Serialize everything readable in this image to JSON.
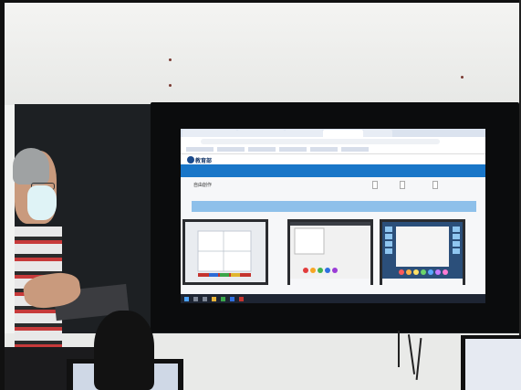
{
  "browser": {
    "tabs": [
      "",
      "",
      "",
      "",
      ""
    ],
    "address": "",
    "bookmarks": [
      "",
      "",
      "",
      "",
      "",
      ""
    ]
  },
  "site": {
    "logo": "教育部",
    "title": "",
    "nav": [
      "",
      "",
      "",
      "",
      "",
      "",
      "",
      ""
    ],
    "page_title": "自由創作",
    "buttons": [
      "",
      "",
      ""
    ],
    "filter_label": "",
    "cards": [
      "",
      "",
      ""
    ]
  },
  "taskbar": {
    "time": ""
  },
  "tv_brand": "",
  "colors": {
    "nav_blue": "#1976c8",
    "filter_blue": "#8ec0ea",
    "board": "#1d2023",
    "wall": "#f2f3f1"
  }
}
